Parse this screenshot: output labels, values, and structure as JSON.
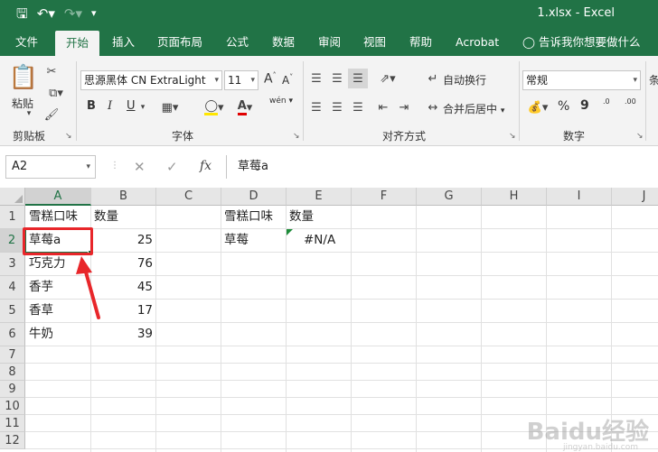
{
  "window": {
    "title": "1.xlsx  -  Excel",
    "qat": {
      "save_icon": "save-icon",
      "undo_icon": "undo-icon",
      "redo_icon": "redo-icon",
      "customize_icon": "customize-qat-icon"
    }
  },
  "tabs": [
    {
      "label": "文件"
    },
    {
      "label": "开始"
    },
    {
      "label": "插入"
    },
    {
      "label": "页面布局"
    },
    {
      "label": "公式"
    },
    {
      "label": "数据"
    },
    {
      "label": "审阅"
    },
    {
      "label": "视图"
    },
    {
      "label": "帮助"
    },
    {
      "label": "Acrobat"
    },
    {
      "label": "告诉我你想要做什么"
    }
  ],
  "ribbon": {
    "clipboard": {
      "paste_label": "粘贴",
      "group_label": "剪贴板"
    },
    "font": {
      "font_name": "思源黑体 CN ExtraLight",
      "font_size": "11",
      "bold": "B",
      "italic": "I",
      "underline": "U",
      "grow": "A",
      "shrink": "A",
      "font_color_letter": "A",
      "phonetic": "wén",
      "group_label": "字体"
    },
    "alignment": {
      "wrap_text": "自动换行",
      "merge_center": "合并后居中",
      "group_label": "对齐方式"
    },
    "number": {
      "format": "常规",
      "percent": "%",
      "comma": "9",
      "increase_decimal": ".0",
      "decrease_decimal": ".00",
      "group_label": "数字"
    },
    "styles": {
      "partial_label": "条"
    }
  },
  "formula_bar": {
    "name_box": "A2",
    "fx": "fx",
    "content": "草莓a"
  },
  "columns": [
    "A",
    "B",
    "C",
    "D",
    "E",
    "F",
    "G",
    "H",
    "I",
    "J"
  ],
  "rows": [
    "1",
    "2",
    "3",
    "4",
    "5",
    "6",
    "7",
    "8",
    "9",
    "10",
    "11",
    "12"
  ],
  "cells": {
    "A1": "雪糕口味",
    "B1": "数量",
    "A2": "草莓a",
    "B2": "25",
    "A3": "巧克力",
    "B3": "76",
    "A4": "香芋",
    "B4": "45",
    "A5": "香草",
    "B5": "17",
    "A6": "牛奶",
    "B6": "39",
    "D1": "雪糕口味",
    "E1": "数量",
    "D2": "草莓",
    "E2": "#N/A"
  },
  "watermark": {
    "text": "Baidu经验",
    "sub": "jingyan.baidu.com"
  },
  "colors": {
    "accent": "#217346",
    "annotation": "#e8262a"
  }
}
